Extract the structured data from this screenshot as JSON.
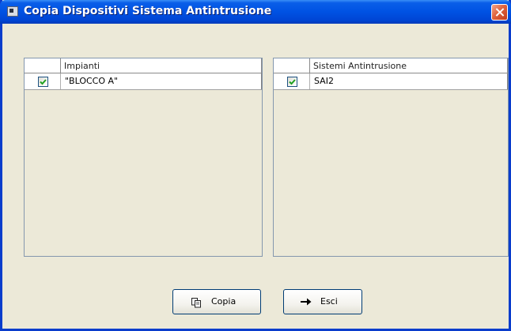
{
  "window": {
    "title": "Copia Dispositivi Sistema Antintrusione",
    "title_bar_color": "#0052e3",
    "background_color": "#ece9d8"
  },
  "left_table": {
    "header": "Impianti",
    "rows": [
      {
        "checked": true,
        "label": "\"BLOCCO A\""
      }
    ]
  },
  "right_table": {
    "header": "Sistemi Antintrusione",
    "rows": [
      {
        "checked": true,
        "label": "SAI2"
      }
    ]
  },
  "buttons": {
    "copy_label": "Copia",
    "copy_icon": "copy-icon",
    "exit_label": "Esci",
    "exit_icon": "arrow-right-icon"
  }
}
